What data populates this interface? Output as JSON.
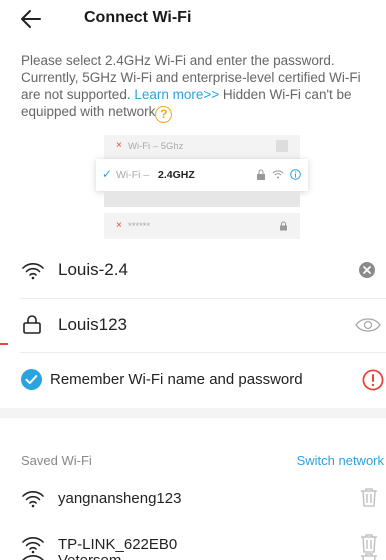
{
  "header": {
    "title": "Connect Wi-Fi"
  },
  "intro": {
    "text": "Please select 2.4GHz Wi-Fi and enter the password. Currently, 5GHz Wi-Fi and enterprise-level certified Wi-Fi are not supported.",
    "learn_more": "Learn more>>",
    "text2": "Hidden Wi-Fi can't be equipped with network",
    "help_glyph": "?"
  },
  "illustration": {
    "row1_x": "×",
    "row1": "Wi-Fi – 5Ghz",
    "row2_check": "✓",
    "row2_prefix": "Wi-Fi – ",
    "row2_strong": "2.4GHZ",
    "row3_x": "×",
    "row3": "******"
  },
  "form": {
    "ssid": "Louis-2.4",
    "password": "Louis123",
    "remember_label": "Remember Wi-Fi name and password"
  },
  "saved": {
    "label": "Saved Wi-Fi",
    "switch_label": "Switch network",
    "networks": [
      {
        "name": "yangnansheng123"
      },
      {
        "name": "TP-LINK_622EB0"
      },
      {
        "name": "Vetersom"
      }
    ]
  },
  "colors": {
    "accent": "#2aa4e0",
    "warning": "#e8463c",
    "help": "#f5a623"
  }
}
